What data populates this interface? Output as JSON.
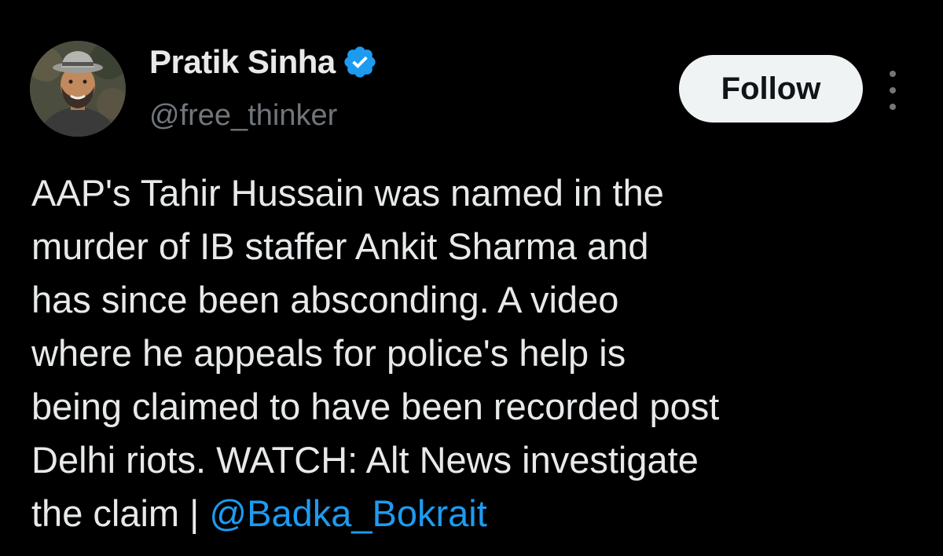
{
  "author": {
    "display_name": "Pratik Sinha",
    "handle": "@free_thinker",
    "verified_icon": "verified-badge-icon",
    "avatar": "profile-photo"
  },
  "actions": {
    "follow_label": "Follow",
    "more_icon": "more-options-icon"
  },
  "tweet": {
    "lines": [
      "AAP's Tahir Hussain was named in the",
      "murder of IB staffer Ankit Sharma and",
      "has since been absconding. A video",
      "where he appeals for police's help is",
      "being claimed to have been recorded post",
      "Delhi riots. WATCH: Alt News investigate",
      "the claim | "
    ],
    "mention": "@Badka_Bokrait"
  },
  "colors": {
    "background": "#000000",
    "text": "#e7e9ea",
    "secondary_text": "#71767b",
    "accent": "#1d9bf0",
    "button_bg": "#eff3f4"
  }
}
